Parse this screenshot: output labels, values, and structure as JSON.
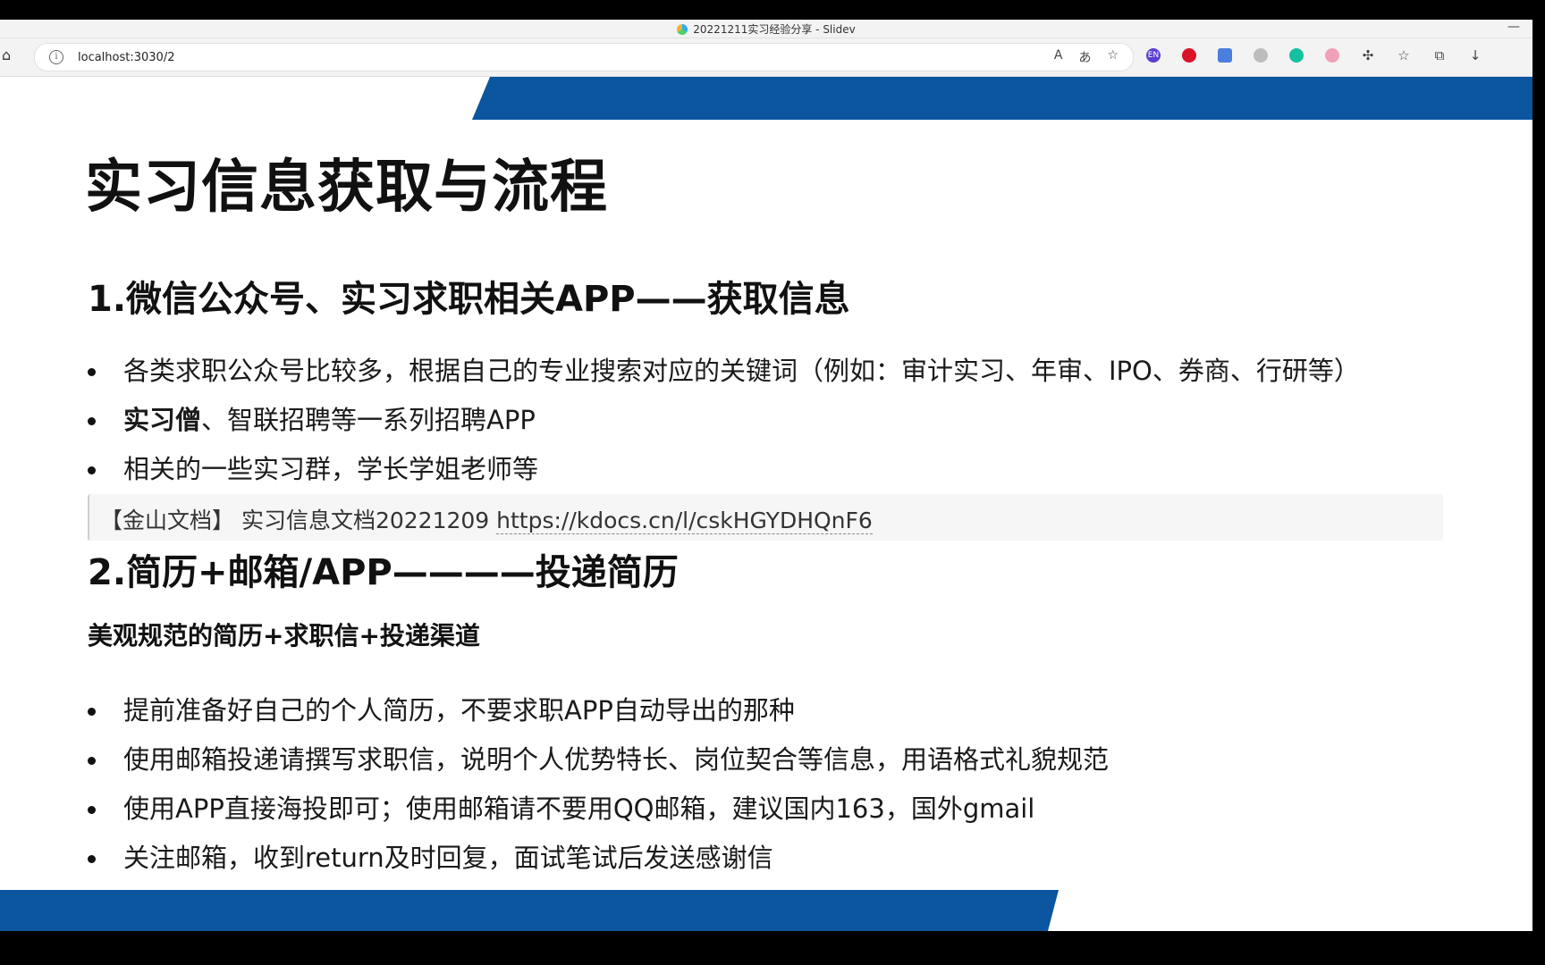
{
  "window": {
    "title": "20221211实习经验分享 - Slidev",
    "minimize": "—"
  },
  "toolbar": {
    "url": "localhost:3030/2",
    "ext_en": "EN"
  },
  "slide": {
    "title": "实习信息获取与流程",
    "section1": "1.微信公众号、实习求职相关APP——获取信息",
    "list1": [
      {
        "text": "各类求职公众号比较多，根据自己的专业搜索对应的关键词（例如：审计实习、年审、IPO、券商、行研等）"
      },
      {
        "bold": "实习僧",
        "text": "、智联招聘等一系列招聘APP"
      },
      {
        "text": "相关的一些实习群，学长学姐老师等"
      }
    ],
    "quote": {
      "prefix": "【金山文档】 实习信息文档20221209 ",
      "link": "https://kdocs.cn/l/cskHGYDHQnF6"
    },
    "section2": "2.简历+邮箱/APP————投递简历",
    "subheading": "美观规范的简历+求职信+投递渠道",
    "list2": [
      "提前准备好自己的个人简历，不要求职APP自动导出的那种",
      "使用邮箱投递请撰写求职信，说明个人优势特长、岗位契合等信息，用语格式礼貌规范",
      "使用APP直接海投即可；使用邮箱请不要用QQ邮箱，建议国内163，国外gmail",
      "关注邮箱，收到return及时回复，面试笔试后发送感谢信"
    ]
  },
  "colors": {
    "band": "#0b569f"
  }
}
